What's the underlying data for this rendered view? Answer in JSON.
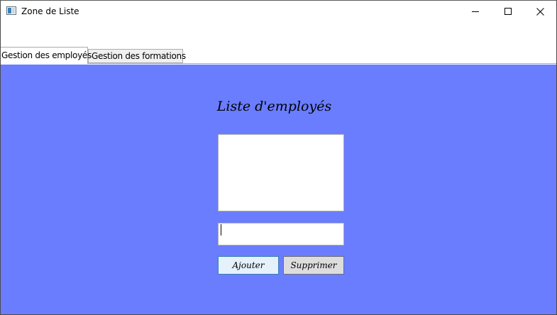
{
  "window": {
    "title": "Zone de Liste"
  },
  "tabs": [
    {
      "label": "Gestion des employés",
      "active": true
    },
    {
      "label": "Gestion des formations",
      "active": false
    }
  ],
  "content": {
    "heading": "Liste d'employés",
    "listbox_items": [],
    "input": {
      "value": "",
      "placeholder": ""
    },
    "buttons": {
      "add_label": "Ajouter",
      "delete_label": "Supprimer"
    }
  },
  "colors": {
    "panel_background": "#6a7dff",
    "focus_border": "#3c7fb1"
  }
}
